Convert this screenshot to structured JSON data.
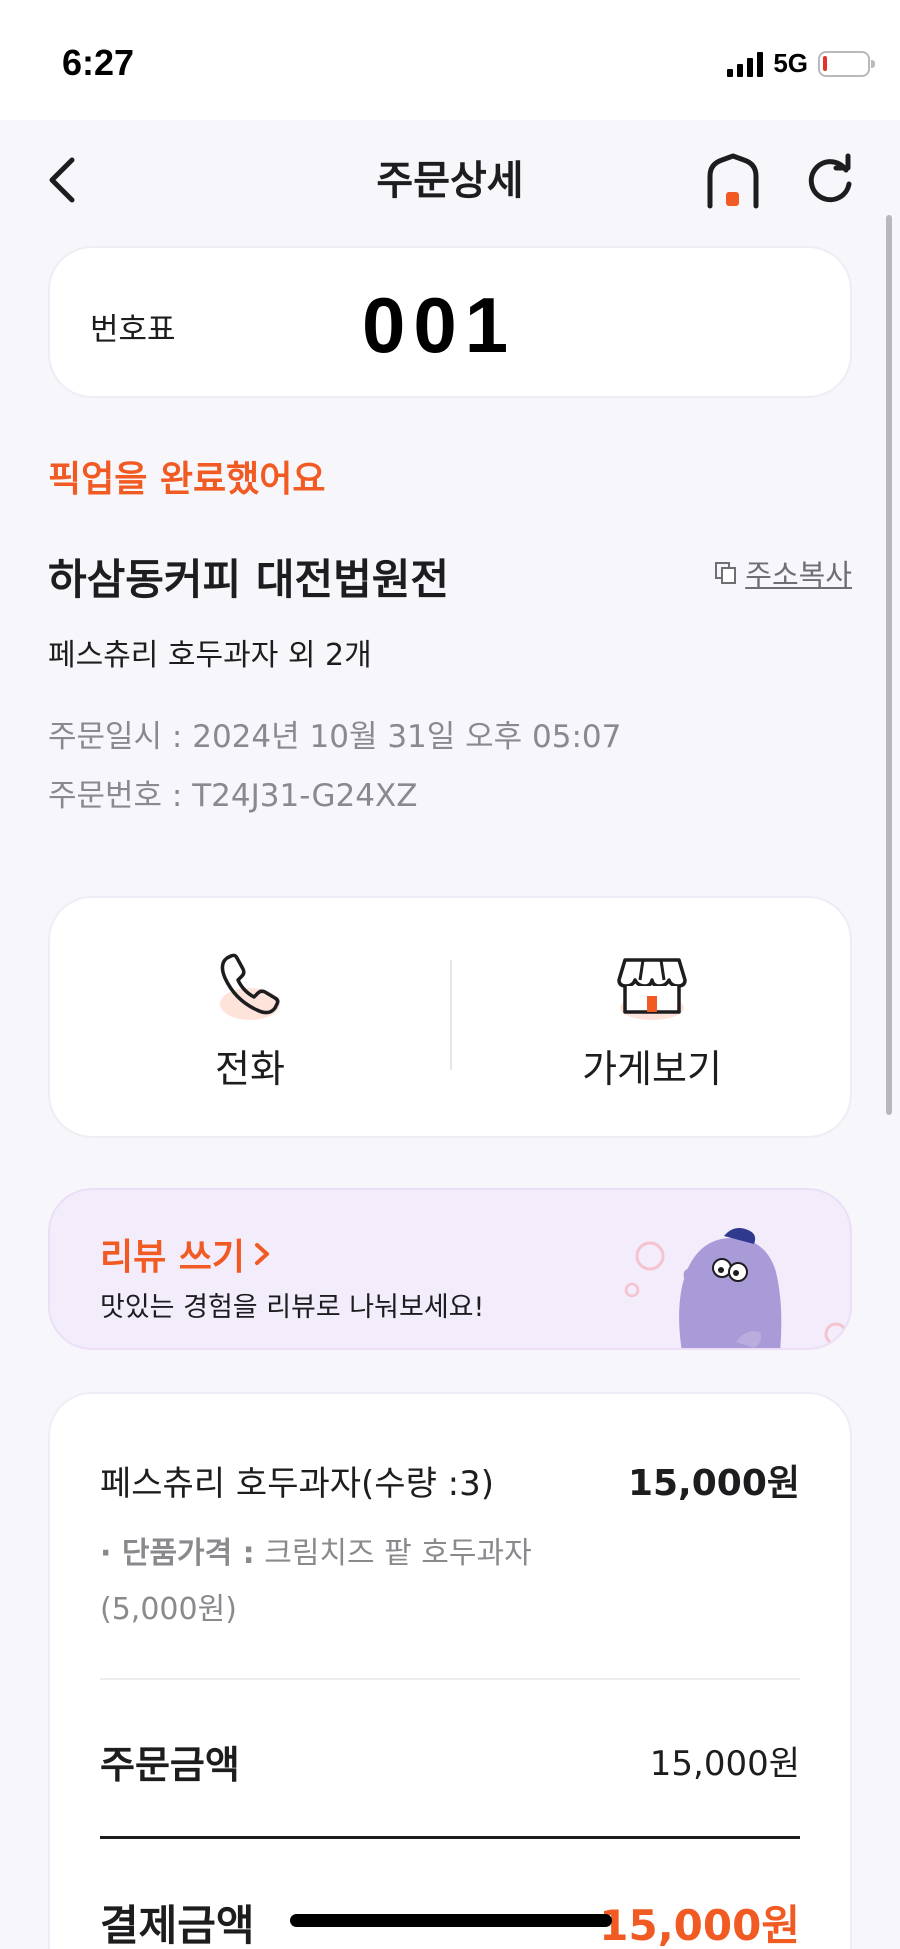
{
  "status_bar": {
    "time": "6:27",
    "network": "5G",
    "battery_level": 0.1
  },
  "nav": {
    "title": "주문상세",
    "back_icon": "chevron-left-icon",
    "home_icon": "home-icon",
    "refresh_icon": "refresh-icon"
  },
  "ticket": {
    "label": "번호표",
    "number": "001"
  },
  "order": {
    "status": "픽업을 완료했어요",
    "store_name": "하삼동커피 대전법원전",
    "copy_address_label": "주소복사",
    "summary": "페스츄리 호두과자 외 2개",
    "date": "주문일시 : 2024년 10월 31일 오후 05:07",
    "number": "주문번호 : T24J31-G24XZ"
  },
  "actions": {
    "call_label": "전화",
    "store_label": "가게보기"
  },
  "review": {
    "title": "리뷰 쓰기",
    "subtitle": "맛있는 경험을 리뷰로 나눠보세요!"
  },
  "details": {
    "item_name": "페스츄리 호두과자(수량 :3)",
    "item_price": "15,000원",
    "option_label": "· 단품가격 :",
    "option_value": " 크림치즈 팥 호두과자 (5,000원)",
    "order_amount_label": "주문금액",
    "order_amount_value": "15,000원",
    "pay_amount_label": "결제금액",
    "pay_amount_value": "15,000원"
  },
  "colors": {
    "accent": "#f15a22",
    "background": "#f7f6fb",
    "review_bg": "#f3ecfb"
  }
}
